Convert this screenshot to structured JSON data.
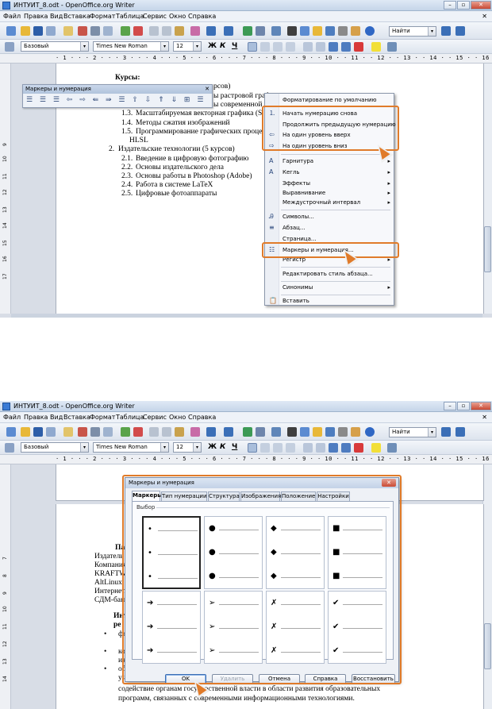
{
  "window": {
    "title": "ИНТУИТ_8.odt - OpenOffice.org Writer",
    "minimize": "–",
    "maximize": "▫",
    "close": "✕"
  },
  "menubar": {
    "items": [
      "Файл",
      "Правка",
      "Вид",
      "Вставка",
      "Формат",
      "Таблица",
      "Сервис",
      "Окно",
      "Справка"
    ],
    "doc_close": "✕"
  },
  "toolbar": {
    "find_placeholder": "Найти",
    "style_value": "Базовый",
    "font_value": "Times New Roman",
    "size_value": "12",
    "bold": "Ж",
    "italic": "К",
    "underline": "Ч"
  },
  "ruler_text": "· 1 · · · 2 · · · 3 · · · 4 · · · 5 · · · 6 · · · 7 · · · 8 · · · 9 · · 10 · · 11 · · 12 · · 13 · · 14 · · 15 · · 16 · · 17 · · 18",
  "vruler_numbers": [
    "9",
    "10",
    "11",
    "12",
    "13",
    "14",
    "15",
    "16",
    "17",
    "18",
    "19",
    "20",
    "21",
    "22"
  ],
  "vruler_numbers2": [
    "7",
    "8",
    "9",
    "10",
    "11",
    "12",
    "13",
    "14",
    "15",
    "16",
    "17",
    "18",
    "19",
    "20"
  ],
  "doc1": {
    "heading": "Курсы:",
    "lines": [
      {
        "num": "",
        "text": "рсов)"
      },
      {
        "num": "",
        "text": "ы растровой граф"
      },
      {
        "num": "",
        "text": "ы современной"
      },
      {
        "num": "1.3.",
        "text": "Масштабируемая векторная графика (S"
      },
      {
        "num": "1.4.",
        "text": "Методы сжатия изображений"
      },
      {
        "num": "1.5.",
        "text": "Программирование графических проце"
      },
      {
        "num": "",
        "text": "HLSL"
      },
      {
        "num": "2.",
        "text": "Издательские технологии (5 курсов)"
      },
      {
        "num": "2.1.",
        "text": "Введение в цифровую фотографию"
      },
      {
        "num": "2.2.",
        "text": "Основы издательского дела"
      },
      {
        "num": "2.3.",
        "text": "Основы работы в Photoshop (Adobe)"
      },
      {
        "num": "2.4.",
        "text": "Работа в системе LaTeX"
      },
      {
        "num": "2.5.",
        "text": "Цифровые фотоаппараты"
      }
    ]
  },
  "floating_toolbar": {
    "title": "Маркеры и нумерация",
    "close": "✕",
    "icons": "☰ ☰ ☰ ⇦ ⇨ ⇚ ⇛ ☰ ⇧ ⇩ ⇑ ⇓ ⊞ ☰"
  },
  "context_menu": {
    "items": [
      {
        "label": "Форматирование по умолчанию",
        "icon": "",
        "sub": ""
      },
      {
        "label": "Начать нумерацию снова",
        "icon": "⒈",
        "sub": ""
      },
      {
        "label": "Продолжить предыдущую нумерацию",
        "icon": "",
        "sub": ""
      },
      {
        "label": "На один уровень вверх",
        "icon": "⇦",
        "sub": ""
      },
      {
        "label": "На один уровень вниз",
        "icon": "⇨",
        "sub": ""
      },
      {
        "label": "Гарнитура",
        "icon": "A",
        "sub": "▸"
      },
      {
        "label": "Кегль",
        "icon": "A",
        "sub": "▸"
      },
      {
        "label": "Эффекты",
        "icon": "",
        "sub": "▸"
      },
      {
        "label": "Выравнивание",
        "icon": "",
        "sub": "▸"
      },
      {
        "label": "Междустрочный интервал",
        "icon": "",
        "sub": "▸"
      },
      {
        "label": "Символы...",
        "icon": "Ꭿ",
        "sub": ""
      },
      {
        "label": "Абзац...",
        "icon": "≡",
        "sub": ""
      },
      {
        "label": "Страница...",
        "icon": "",
        "sub": ""
      },
      {
        "label": "Маркеры и нумерация...",
        "icon": "☷",
        "sub": ""
      },
      {
        "label": "Регистр",
        "icon": "",
        "sub": "▸"
      },
      {
        "label": "Редактировать стиль абзаца...",
        "icon": "",
        "sub": ""
      },
      {
        "label": "Синонимы",
        "icon": "",
        "sub": "▸"
      },
      {
        "label": "Вставить",
        "icon": "📋",
        "sub": ""
      }
    ]
  },
  "doc2": {
    "lines": [
      "Пар",
      "Издатель",
      "Компания",
      "KRAFTW",
      "AltLinux",
      "Интернет-",
      "СДМ-бан",
      "Инт",
      "ре",
      "фо",
      "ко",
      "из",
      "обе",
      "уча",
      "содействие органам государственной власти в области развития образовательных",
      "программ, связанных с современными информационными технологиями."
    ]
  },
  "dialog": {
    "title": "Маркеры и нумерация",
    "close": "✕",
    "tabs": [
      "Маркеры",
      "Тип нумерации",
      "Структура",
      "Изображения",
      "Положение",
      "Настройки"
    ],
    "group_label": "Выбор",
    "bullets": [
      "•",
      "●",
      "◆",
      "■",
      "➔",
      "➢",
      "✗",
      "✔"
    ],
    "buttons": {
      "ok": "OK",
      "delete": "Удалить",
      "cancel": "Отмена",
      "help": "Справка",
      "reset": "Восстановить"
    }
  },
  "colors": {
    "highlight": "#e07b2a",
    "accent": "#3a7bd5"
  }
}
